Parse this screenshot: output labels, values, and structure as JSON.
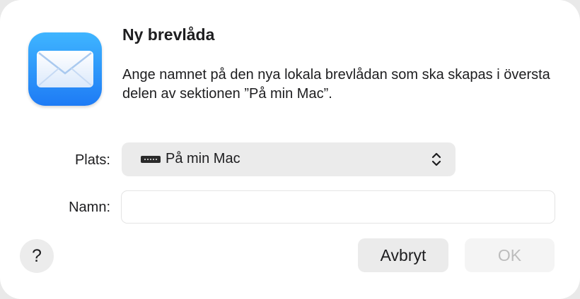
{
  "dialog": {
    "title": "Ny brevlåda",
    "message": "Ange namnet på den nya lokala brevlådan som ska skapas i översta delen av sektionen ”På min Mac”.",
    "app_icon": "mail-icon"
  },
  "location": {
    "label": "Plats:",
    "value": "På min Mac",
    "icon": "disk-icon"
  },
  "name": {
    "label": "Namn:",
    "value": "",
    "placeholder": ""
  },
  "buttons": {
    "help_label": "?",
    "cancel_label": "Avbryt",
    "ok_label": "OK",
    "ok_enabled": false
  }
}
